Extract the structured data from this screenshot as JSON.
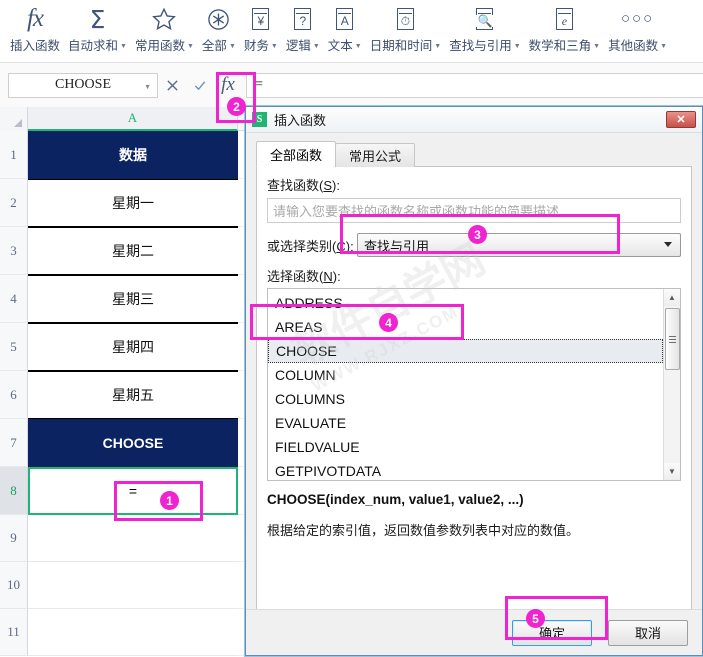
{
  "ribbon": {
    "items": [
      {
        "label": "插入函数",
        "icon": "fx-icon",
        "caret": false
      },
      {
        "label": "自动求和",
        "icon": "sigma-icon",
        "caret": true
      },
      {
        "label": "常用函数",
        "icon": "star-icon",
        "caret": true
      },
      {
        "label": "全部",
        "icon": "asterisk-circle-icon",
        "caret": true
      },
      {
        "label": "财务",
        "icon": "yen-book-icon",
        "caret": true
      },
      {
        "label": "逻辑",
        "icon": "question-book-icon",
        "caret": true
      },
      {
        "label": "文本",
        "icon": "letter-a-book-icon",
        "caret": true
      },
      {
        "label": "日期和时间",
        "icon": "clock-book-icon",
        "caret": true
      },
      {
        "label": "查找与引用",
        "icon": "magnifier-book-icon",
        "caret": true
      },
      {
        "label": "数学和三角",
        "icon": "letter-e-book-icon",
        "caret": true
      },
      {
        "label": "其他函数",
        "icon": "ellipsis-icon",
        "caret": true
      }
    ]
  },
  "formula_bar": {
    "name_box_value": "CHOOSE",
    "cancel_icon": "close-icon",
    "confirm_icon": "check-icon",
    "fx_icon": "fx-icon",
    "formula_value": "="
  },
  "grid": {
    "column_header": "A",
    "rows": [
      {
        "num": "1",
        "value": "数据",
        "style": "hdr"
      },
      {
        "num": "2",
        "value": "星期一",
        "style": "data"
      },
      {
        "num": "3",
        "value": "星期二",
        "style": "data"
      },
      {
        "num": "4",
        "value": "星期三",
        "style": "data"
      },
      {
        "num": "5",
        "value": "星期四",
        "style": "data"
      },
      {
        "num": "6",
        "value": "星期五",
        "style": "data"
      },
      {
        "num": "7",
        "value": "CHOOSE",
        "style": "hdr"
      },
      {
        "num": "8",
        "value": "=",
        "style": "selected"
      },
      {
        "num": "9",
        "value": "",
        "style": "plain"
      },
      {
        "num": "10",
        "value": "",
        "style": "plain"
      },
      {
        "num": "11",
        "value": "",
        "style": "plain"
      }
    ],
    "header_bg": "#0b2360",
    "selection_color": "#21b573"
  },
  "dialog": {
    "title": "插入函数",
    "icon": "spreadsheet-app-icon",
    "icon_letter": "S",
    "close_label": "✕",
    "tabs": [
      {
        "label": "全部函数",
        "active": true
      },
      {
        "label": "常用公式",
        "active": false
      }
    ],
    "search_label": "查找函数(S):",
    "search_placeholder": "请输入您要查找的函数名称或函数功能的简要描述...",
    "search_value": "",
    "category_label": "或选择类别(C):",
    "category_value": "查找与引用",
    "category_options": [
      "查找与引用"
    ],
    "function_list_label": "选择函数(N):",
    "functions": [
      {
        "name": "ADDRESS",
        "selected": false
      },
      {
        "name": "AREAS",
        "selected": false
      },
      {
        "name": "CHOOSE",
        "selected": true
      },
      {
        "name": "COLUMN",
        "selected": false
      },
      {
        "name": "COLUMNS",
        "selected": false
      },
      {
        "name": "EVALUATE",
        "selected": false
      },
      {
        "name": "FIELDVALUE",
        "selected": false
      },
      {
        "name": "GETPIVOTDATA",
        "selected": false
      }
    ],
    "syntax": "CHOOSE(index_num, value1, value2, ...)",
    "description": "根据给定的索引值，返回数值参数列表中对应的数值。",
    "ok_label": "确定",
    "cancel_label": "取消"
  },
  "annotations": {
    "accent_color": "#ef23d0",
    "steps": [
      {
        "num": "1",
        "target": "cell-A8-equals"
      },
      {
        "num": "2",
        "target": "formula-bar-fx-button"
      },
      {
        "num": "3",
        "target": "category-select"
      },
      {
        "num": "4",
        "target": "function-choose"
      },
      {
        "num": "5",
        "target": "ok-button"
      }
    ]
  },
  "watermark": {
    "text": "软件自学网",
    "sub": "WWW.RJXZ.COM"
  }
}
